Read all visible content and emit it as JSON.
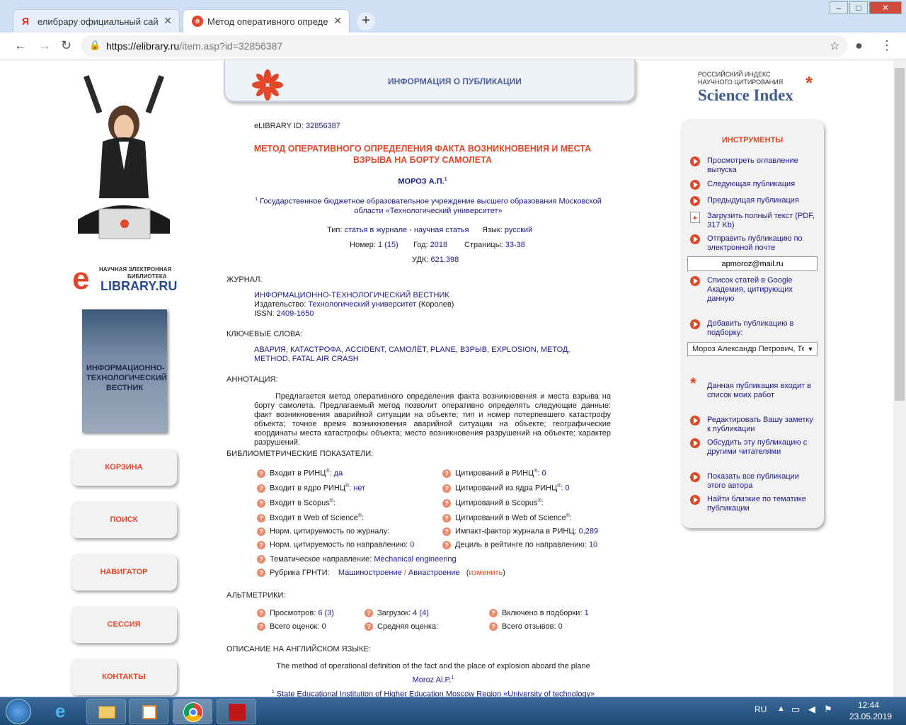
{
  "browser": {
    "tabs": [
      {
        "label": "елибрару официальный сайт —"
      },
      {
        "label": "Метод оперативного определе"
      }
    ],
    "url_base": "https://elibrary.ru",
    "url_path": "/item.asp?id=32856387"
  },
  "header": {
    "title": "ИНФОРМАЦИЯ О ПУБЛИКАЦИИ"
  },
  "logo": {
    "line1": "НАУЧНАЯ ЭЛЕКТРОННАЯ",
    "line2": "БИБЛИОТЕКА",
    "brand": "LIBRARY.RU",
    "e": "e"
  },
  "science_index": {
    "line1": "РОССИЙСКИЙ ИНДЕКС",
    "line2": "НАУЧНОГО ЦИТИРОВАНИЯ",
    "brand": "Science Index"
  },
  "journal_cover": {
    "title": "ИНФОРМАЦИОННО-ТЕХНОЛОГИЧЕСКИЙ ВЕСТНИК"
  },
  "left_menu": [
    "КОРЗИНА",
    "ПОИСК",
    "НАВИГАТОР",
    "СЕССИЯ",
    "КОНТАКТЫ"
  ],
  "article": {
    "elibrary_id_label": "eLIBRARY ID:",
    "elibrary_id": "32856387",
    "title": "МЕТОД ОПЕРАТИВНОГО ОПРЕДЕЛЕНИЯ ФАКТА ВОЗНИКНОВЕНИЯ И МЕСТА ВЗРЫВА НА БОРТУ САМОЛЕТА",
    "author": "МОРОЗ А.П.",
    "author_sup": "1",
    "affil_sup": "1",
    "affiliation": "Государственное бюджетное образовательное учреждение высшего образования Московской области «Технологический университет»",
    "type_label": "Тип:",
    "type": "статья в журнале - научная статья",
    "lang_label": "Язык:",
    "lang": "русский",
    "number_label": "Номер:",
    "number": "1 (15)",
    "year_label": "Год:",
    "year": "2018",
    "pages_label": "Страницы:",
    "pages": "33-38",
    "udk_label": "УДК:",
    "udk": "621.398"
  },
  "journal": {
    "label": "ЖУРНАЛ:",
    "name": "ИНФОРМАЦИОННО-ТЕХНОЛОГИЧЕСКИЙ ВЕСТНИК",
    "publisher_label": "Издательство:",
    "publisher": "Технологический университет",
    "publisher_city": "(Королев)",
    "issn_label": "ISSN:",
    "issn": "2409-1650"
  },
  "keywords": {
    "label": "КЛЮЧЕВЫЕ СЛОВА:",
    "items": [
      "АВАРИЯ",
      "КАТАСТРОФА",
      "ACCIDENT",
      "САМОЛЁТ",
      "PLANE",
      "ВЗРЫВ",
      "EXPLOSION",
      "МЕТОД",
      "METHOD",
      "FATAL AIR CRASH"
    ]
  },
  "annotation": {
    "label": "АННОТАЦИЯ:",
    "text": "Предлагается метод оперативного определения факта возникновения и места взрыва на борту самолета. Предлагаемый метод позволит оперативно определять следующие данные: факт возникновения аварийной ситуации на объекте; тип и номер потерпевшего катастрофу объекта; точное время возникновения аварийной ситуации на объекте; географические координаты места катастрофы объекта; место возникновения разрушений на объекте; характер разрушений."
  },
  "biblio": {
    "label": "БИБЛИОМЕТРИЧЕСКИЕ ПОКАЗАТЕЛИ:",
    "left": [
      {
        "k": "Входит в РИНЦ",
        "sup": "®",
        "sep": ":",
        "v": "да"
      },
      {
        "k": "Входит в ядро РИНЦ",
        "sup": "®",
        "sep": ":",
        "v": "нет"
      },
      {
        "k": "Входит в Scopus",
        "sup": "®",
        "sep": ":",
        "v": ""
      },
      {
        "k": "Входит в Web of Science",
        "sup": "®",
        "sep": ":",
        "v": ""
      },
      {
        "k": "Норм. цитируемость по журналу:",
        "sup": "",
        "sep": "",
        "v": ""
      },
      {
        "k": "Норм. цитируемость по направлению:",
        "sup": "",
        "sep": "",
        "v": "0"
      }
    ],
    "right": [
      {
        "k": "Цитирований в РИНЦ",
        "sup": "®",
        "sep": ":",
        "v": "0"
      },
      {
        "k": "Цитирований из ядра РИНЦ",
        "sup": "®",
        "sep": ":",
        "v": "0"
      },
      {
        "k": "Цитирований в Scopus",
        "sup": "®",
        "sep": ":",
        "v": ""
      },
      {
        "k": "Цитирований в Web of Science",
        "sup": "®",
        "sep": ":",
        "v": ""
      },
      {
        "k": "Импакт-фактор журнала в РИНЦ:",
        "sup": "",
        "sep": "",
        "v": "0,289"
      },
      {
        "k": "Дециль в рейтинге по направлению:",
        "sup": "",
        "sep": "",
        "v": "10"
      }
    ],
    "direction_label": "Тематическое направление:",
    "direction": "Mechanical engineering",
    "grnti_label": "Рубрика ГРНТИ:",
    "grnti1": "Машиностроение",
    "grnti_sep": "/",
    "grnti2": "Авиастроение",
    "change_open": "(",
    "change": "изменить",
    "change_close": ")"
  },
  "altmetrics": {
    "label": "АЛЬТМЕТРИКИ:",
    "views_label": "Просмотров:",
    "views": "6 (3)",
    "downloads_label": "Загрузок:",
    "downloads": "4 (4)",
    "collections_label": "Включено в подборки:",
    "collections": "1",
    "ratings_label": "Всего оценок:",
    "ratings": "0",
    "avg_label": "Средняя оценка:",
    "reviews_label": "Всего отзывов:",
    "reviews": "0"
  },
  "english": {
    "label": "ОПИСАНИЕ НА АНГЛИЙСКОМ ЯЗЫКЕ:",
    "title": "The method of operational definition of the fact and the place of explosion aboard the plane",
    "author": "Moroz Al.P.",
    "author_sup": "1",
    "affil_sup": "1",
    "affil": "State Educational Institution of Higher Education Moscow Region «University of technology»"
  },
  "tools": {
    "title": "ИНСТРУМЕНТЫ",
    "items": [
      "Просмотреть оглавление выпуска",
      "Следующая публикация",
      "Предыдущая публикация",
      "Загрузить полный текст (PDF, 317 Kb)",
      "Отправить публикацию по электронной почте"
    ],
    "email": "apmoroz@mail.ru",
    "items2": [
      "Список статей в Google Академия, цитирующих данную",
      "Добавить публикацию в подборку:"
    ],
    "collection_select": "Мороз Александр Петрович, Тех",
    "my_works": "Данная публикация входит в список моих работ",
    "items3": [
      "Редактировать Вашу заметку к публикации",
      "Обсудить эту публикацию с другими читателями"
    ],
    "items4": [
      "Показать все публикации этого автора",
      "Найти близкие по тематике публикации"
    ]
  },
  "taskbar": {
    "lang": "RU",
    "time": "12:44",
    "date": "23.05.2019"
  },
  "colors": {
    "accent": "#e3472a",
    "link": "#1a1a8c",
    "header_text": "#4a5f9e"
  }
}
